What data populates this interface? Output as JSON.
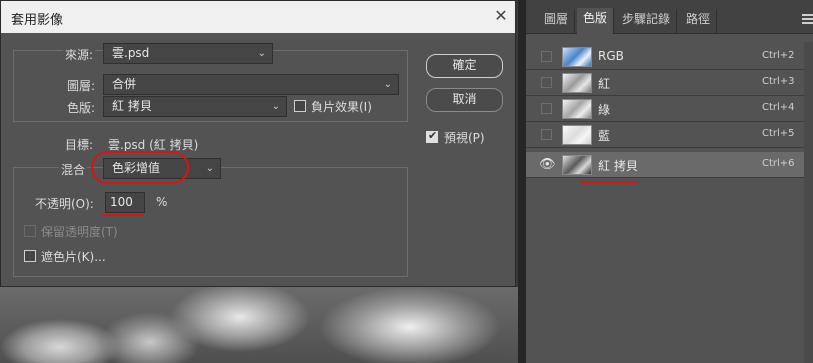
{
  "dialog": {
    "title": "套用影像",
    "source_label": "來源:",
    "source_value": "雲.psd",
    "layer_label": "圖層:",
    "layer_value": "合併",
    "channel_label": "色版:",
    "channel_value": "紅 拷貝",
    "invert_label": "負片效果(I)",
    "target_label": "目標:",
    "target_value": "雲.psd (紅 拷貝)",
    "blending_label": "混合",
    "blending_value": "色彩增值",
    "opacity_label": "不透明(O):",
    "opacity_value": "100",
    "opacity_unit": "%",
    "preserve_transparency_label": "保留透明度(T)",
    "mask_label": "遮色片(K)...",
    "ok_label": "確定",
    "cancel_label": "取消",
    "preview_label": "預視(P)",
    "preview_checked": true
  },
  "panel": {
    "tabs": [
      "圖層",
      "色版",
      "步驟記錄",
      "路徑"
    ],
    "active_tab": "色版",
    "channels": [
      {
        "name": "RGB",
        "shortcut": "Ctrl+2",
        "visible": false,
        "selected": false
      },
      {
        "name": "紅",
        "shortcut": "Ctrl+3",
        "visible": false,
        "selected": false
      },
      {
        "name": "綠",
        "shortcut": "Ctrl+4",
        "visible": false,
        "selected": false
      },
      {
        "name": "藍",
        "shortcut": "Ctrl+5",
        "visible": false,
        "selected": false
      },
      {
        "name": "紅 拷貝",
        "shortcut": "Ctrl+6",
        "visible": true,
        "selected": true
      }
    ]
  },
  "colors": {
    "annotation_red": "#d81414",
    "dialog_bg": "#535353",
    "panel_bg": "#535353"
  }
}
